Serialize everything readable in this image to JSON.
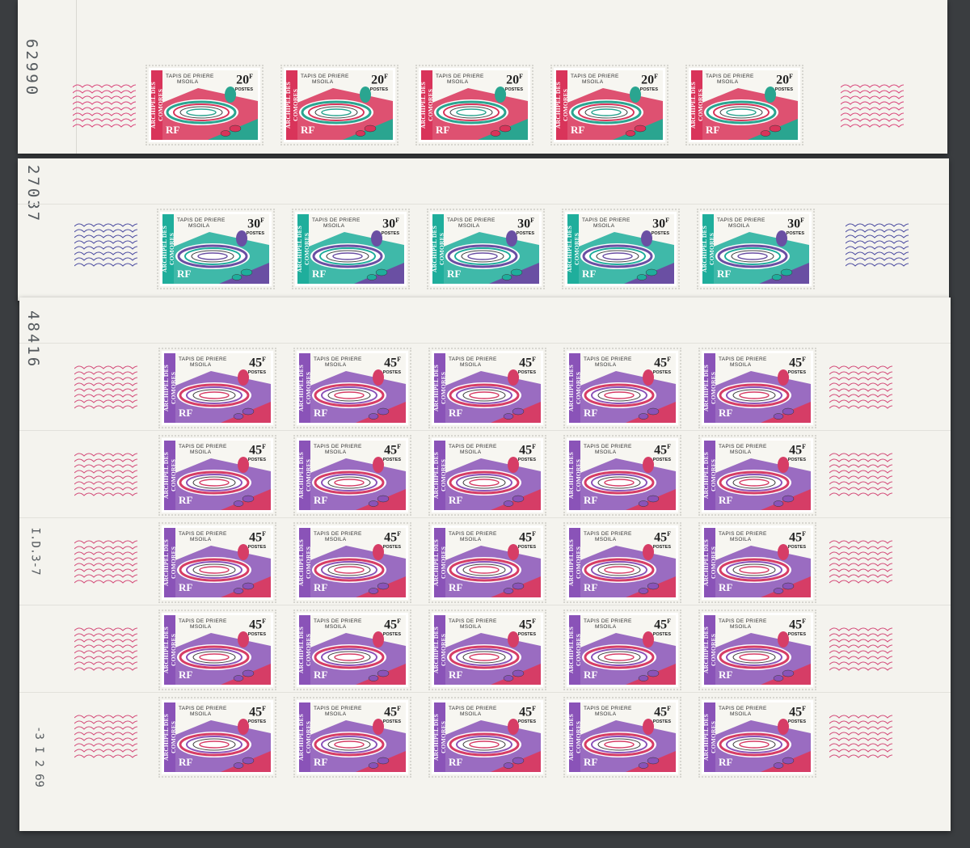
{
  "sheets": [
    {
      "number": "62990",
      "stamp": {
        "title_line1": "TAPIS DE PRIERE",
        "title_line2": "MSOILA",
        "value": "20",
        "unit": "F",
        "postes": "POSTES",
        "country": "ARCHIPEL DES COMORES",
        "rf": "RF"
      },
      "colors": {
        "primary": "#d9345a",
        "secondary": "#2aa590",
        "wave": "#d9457a"
      },
      "rows": 1,
      "cols": 5
    },
    {
      "number": "27037",
      "stamp": {
        "title_line1": "TAPIS DE PRIERE",
        "title_line2": "MSOILA",
        "value": "30",
        "unit": "F",
        "postes": "POSTES",
        "country": "ARCHIPEL DES COMORES",
        "rf": "RF"
      },
      "colors": {
        "primary": "#1fae9c",
        "secondary": "#6a4fa3",
        "wave": "#4a4aa0"
      },
      "rows": 1,
      "cols": 5
    },
    {
      "number": "48416",
      "stamp": {
        "title_line1": "TAPIS DE PRIERE",
        "title_line2": "MSOILA",
        "value": "45",
        "unit": "F",
        "postes": "POSTES",
        "country": "ARCHIPEL DES COMORES",
        "rf": "RF"
      },
      "colors": {
        "primary": "#8a53b8",
        "secondary": "#d63d66",
        "wave": "#d34a78"
      },
      "rows": 5,
      "cols": 5,
      "margin_code": "I.D.3-7",
      "date_code": "-3 I 2 69"
    }
  ]
}
